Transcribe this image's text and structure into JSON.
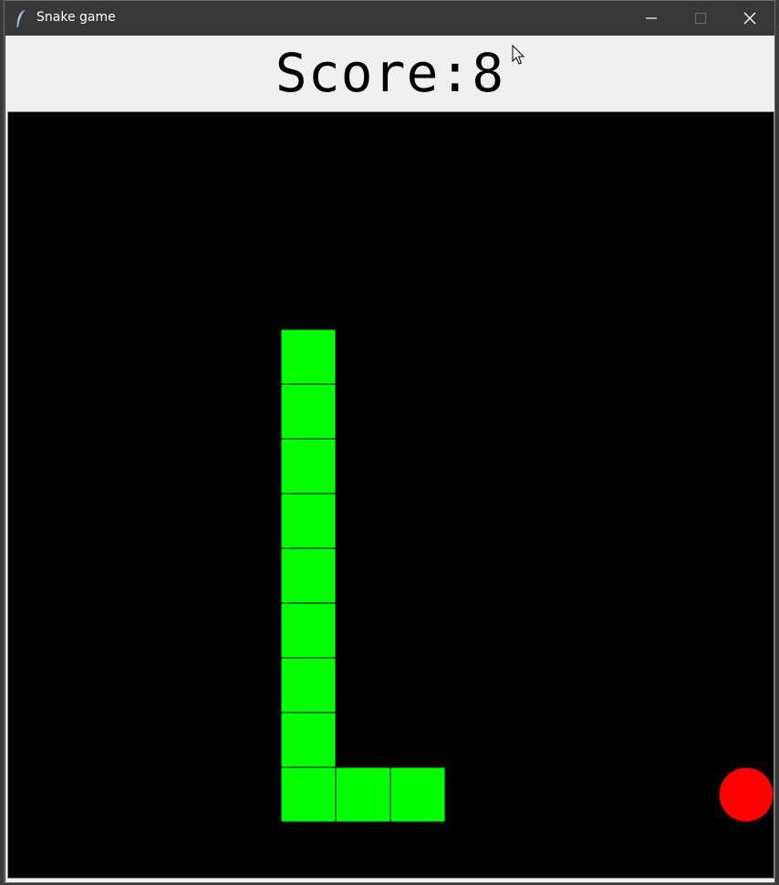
{
  "window": {
    "title": "Snake game",
    "icons": {
      "app": "feather-icon",
      "minimize": "minimize-icon",
      "maximize": "maximize-icon",
      "close": "close-icon"
    }
  },
  "game": {
    "score_label": "Score:8",
    "score": 8,
    "background_color": "#000000",
    "grid": {
      "columns": 14,
      "rows": 14
    },
    "snake": {
      "color": "#00ff00",
      "segments": [
        {
          "col": 5,
          "row": 4
        },
        {
          "col": 5,
          "row": 5
        },
        {
          "col": 5,
          "row": 6
        },
        {
          "col": 5,
          "row": 7
        },
        {
          "col": 5,
          "row": 8
        },
        {
          "col": 5,
          "row": 9
        },
        {
          "col": 5,
          "row": 10
        },
        {
          "col": 5,
          "row": 11
        },
        {
          "col": 5,
          "row": 12
        },
        {
          "col": 6,
          "row": 12
        },
        {
          "col": 7,
          "row": 12
        }
      ]
    },
    "food": {
      "color": "#ff0000",
      "col": 13,
      "row": 12
    }
  }
}
